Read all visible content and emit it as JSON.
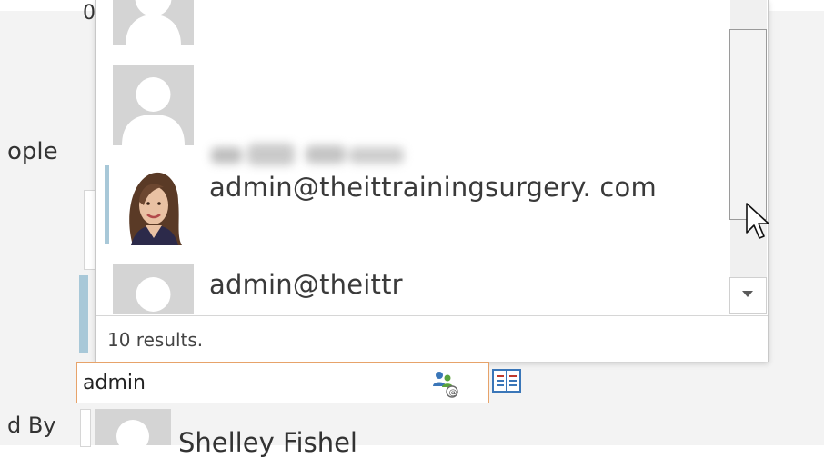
{
  "background": {
    "left_fragments": {
      "top_char": "0",
      "people_label": "ople",
      "by_label": "d By"
    },
    "lower_contact_name": "Shelley Fishel"
  },
  "dropdown": {
    "contacts": [
      {
        "id": "c0",
        "label": "",
        "photo": "placeholder",
        "accent": "none"
      },
      {
        "id": "c1",
        "label": "",
        "photo": "placeholder",
        "accent": "none",
        "blurred": true
      },
      {
        "id": "c2",
        "label": "admin@theittrainingsurgery. com",
        "photo": "woman-portrait",
        "accent": "#a8c8d8"
      },
      {
        "id": "c3",
        "label": "admin@theittr",
        "photo": "placeholder",
        "accent": "none"
      }
    ],
    "results_text": "10 results."
  },
  "search": {
    "value": "admin",
    "placeholder": ""
  },
  "colors": {
    "accent_blue": "#a8c8d8",
    "input_border": "#e7a36a",
    "icon_blue": "#3a76b8",
    "icon_green": "#5aa33c"
  },
  "icons": [
    "person-placeholder-icon",
    "people-suggest-icon",
    "address-book-icon",
    "scroll-down-arrow-icon",
    "mouse-cursor-icon"
  ]
}
